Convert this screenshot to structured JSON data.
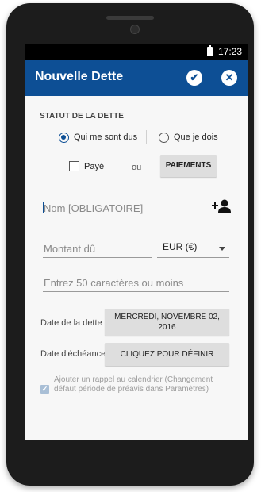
{
  "statusbar": {
    "time": "17:23",
    "battery_icon": "battery-icon"
  },
  "appbar": {
    "title": "Nouvelle Dette",
    "confirm_icon": "✔",
    "cancel_icon": "✕",
    "color": "#0d4f95"
  },
  "status_section": {
    "title": "STATUT DE LA DETTE",
    "option_owed_to_me": "Qui me sont dus",
    "option_i_owe": "Que je dois",
    "selected": "Qui me sont dus",
    "paid_label": "Payé",
    "paid_checked": false,
    "or_label": "ou",
    "payments_button": "PAIEMENTS"
  },
  "form": {
    "name_placeholder": "Nom [OBLIGATOIRE]",
    "amount_placeholder": "Montant dû",
    "currency": "EUR (€)",
    "note_placeholder": "Entrez 50 caractères ou moins",
    "debt_date_label": "Date de la dette",
    "debt_date_value": "MERCREDI, NOVEMBRE 02, 2016",
    "due_date_label": "Date d'échéance",
    "due_date_button": "CLIQUEZ POUR DÉFINIR",
    "reminder_text": "Ajouter un rappel au calendrier (Changement défaut période de préavis dans Paramètres)",
    "reminder_checked": true
  }
}
